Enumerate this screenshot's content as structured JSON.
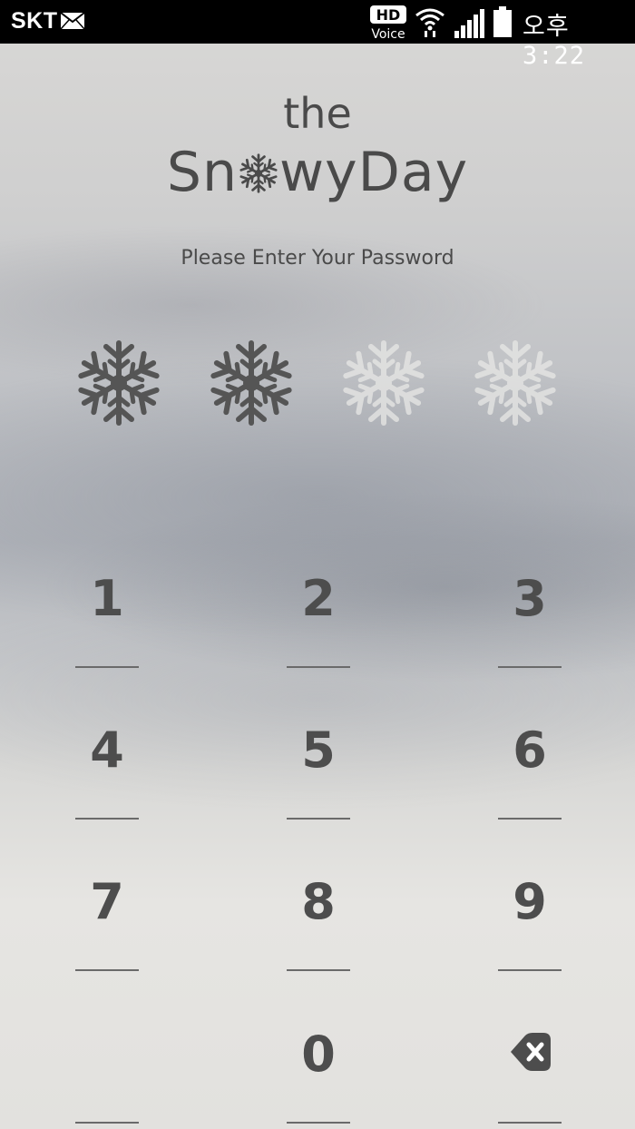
{
  "status_bar": {
    "carrier": "SKT",
    "hd_label": "HD",
    "voice_label": "Voice",
    "time": "오후 3:22",
    "icons": [
      "mail-icon",
      "hd-voice-icon",
      "wifi-icon",
      "signal-icon",
      "battery-icon"
    ]
  },
  "logo": {
    "line1": "the",
    "name_prefix": "Sn",
    "name_suffix": "wyDay"
  },
  "prompt": "Please Enter Your Password",
  "pin": {
    "length": 4,
    "entered": 2,
    "filled_color": "#555555",
    "empty_color": "#e8e8e6"
  },
  "keypad": {
    "keys": [
      "1",
      "2",
      "3",
      "4",
      "5",
      "6",
      "7",
      "8",
      "9",
      "",
      "0",
      "backspace-icon"
    ]
  },
  "colors": {
    "text": "#4a4a4a",
    "status_bar_bg": "#000000"
  }
}
